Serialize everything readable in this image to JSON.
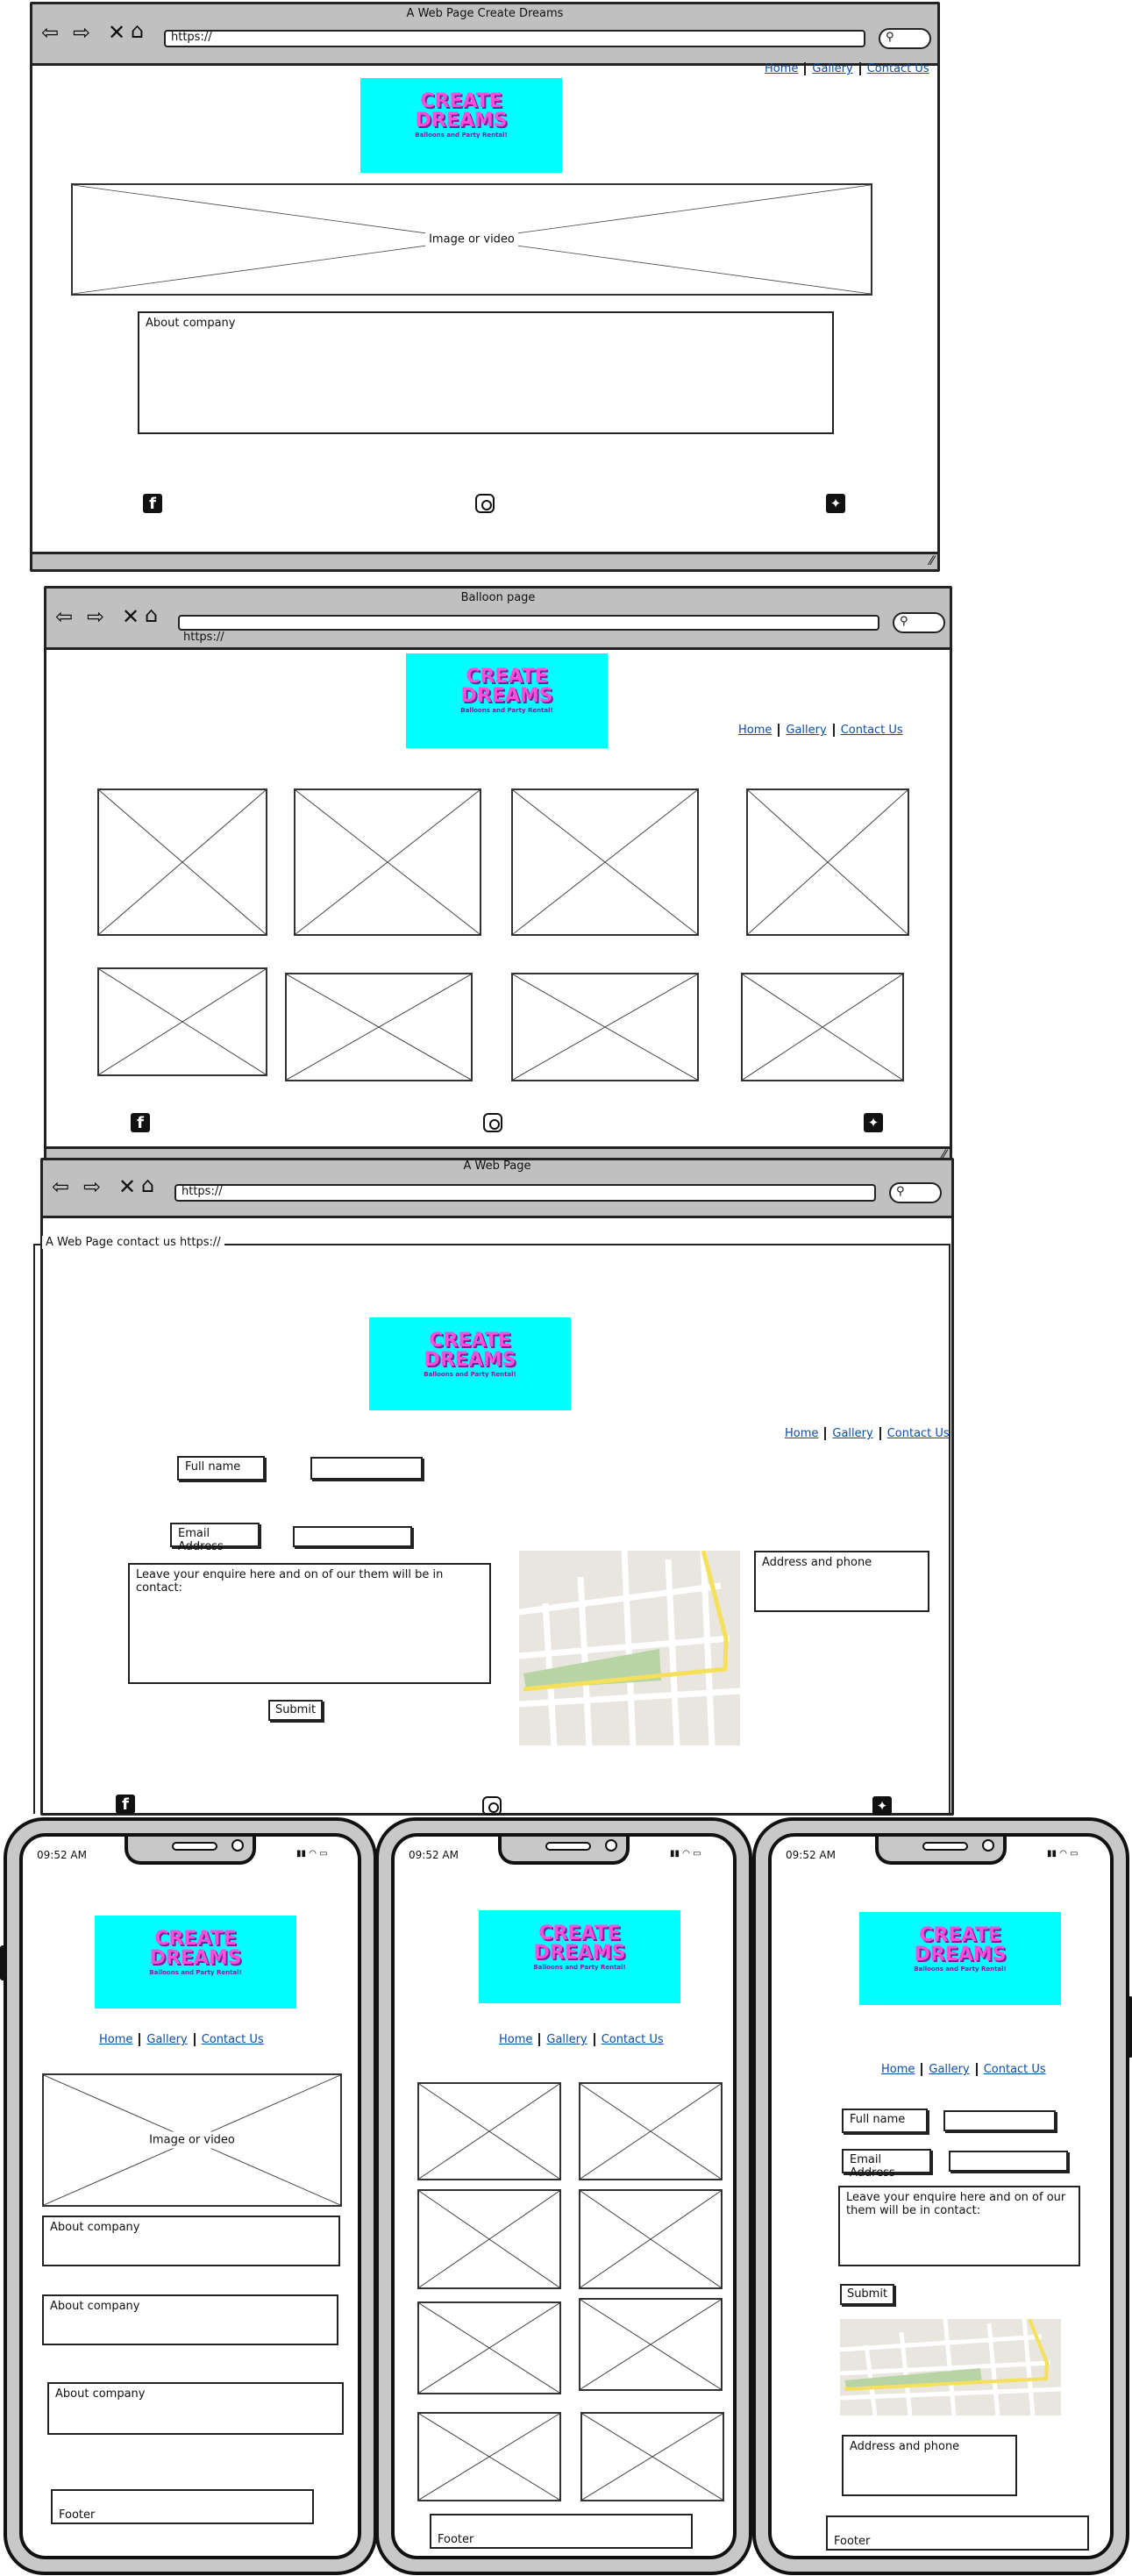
{
  "desktop_home": {
    "window_title": "A Web Page Create Dreams",
    "url": "https://",
    "nav": [
      "Home",
      "Gallery",
      "Contact Us"
    ],
    "logo": {
      "line1": "CREATE",
      "line2": "DREAMS",
      "tagline": "Balloons and Party Rental!"
    },
    "hero_label": "Image or video",
    "about_label": "About company"
  },
  "desktop_gallery": {
    "window_title": "Balloon page",
    "url": "https://",
    "nav": [
      "Home",
      "Gallery",
      "Contact Us"
    ],
    "logo": {
      "line1": "CREATE",
      "line2": "DREAMS",
      "tagline": "Balloons and Party Rental!"
    }
  },
  "desktop_contact": {
    "window_title": "A Web Page",
    "url": "https://",
    "fieldset_legend": "A Web Page contact us https://",
    "nav": [
      "Home",
      "Gallery",
      "Contact Us"
    ],
    "logo": {
      "line1": "CREATE",
      "line2": "DREAMS",
      "tagline": "Balloons and Party Rental!"
    },
    "full_name_label": "Full name",
    "email_label": "Email Address",
    "message_placeholder": "Leave your enquire here and on of our them will be in contact:",
    "submit_label": "Submit",
    "address_label": "Address and phone"
  },
  "mobile_home": {
    "time": "09:52 AM",
    "logo": {
      "line1": "CREATE",
      "line2": "DREAMS",
      "tagline": "Balloons and Party Rental!"
    },
    "nav": [
      "Home",
      "Gallery",
      "Contact Us"
    ],
    "hero_label": "Image or video",
    "about_labels": [
      "About company",
      "About company",
      "About company"
    ],
    "footer_label": "Footer"
  },
  "mobile_gallery": {
    "time": "09:52 AM",
    "logo": {
      "line1": "CREATE",
      "line2": "DREAMS",
      "tagline": "Balloons and Party Rental!"
    },
    "nav": [
      "Home",
      "Gallery",
      "Contact Us"
    ],
    "footer_label": "Footer"
  },
  "mobile_contact": {
    "time": "09:52 AM",
    "logo": {
      "line1": "CREATE",
      "line2": "DREAMS",
      "tagline": "Balloons and Party Rental!"
    },
    "nav": [
      "Home",
      "Gallery",
      "Contact Us"
    ],
    "full_name_label": "Full name",
    "email_label": "Email Address",
    "message_placeholder": "Leave your enquire here and on of our them will be in contact:",
    "submit_label": "Submit",
    "address_label": "Address and phone",
    "footer_label": "Footer"
  },
  "colors": {
    "logo_bg": "#00ffff",
    "logo_text": "#ff4fd8",
    "link": "#0b4ea2",
    "chrome": "#c0c0c0"
  },
  "icons": [
    "back-arrow-icon",
    "forward-arrow-icon",
    "close-x-icon",
    "home-icon",
    "search-icon",
    "facebook-icon",
    "instagram-icon",
    "twitter-icon"
  ]
}
